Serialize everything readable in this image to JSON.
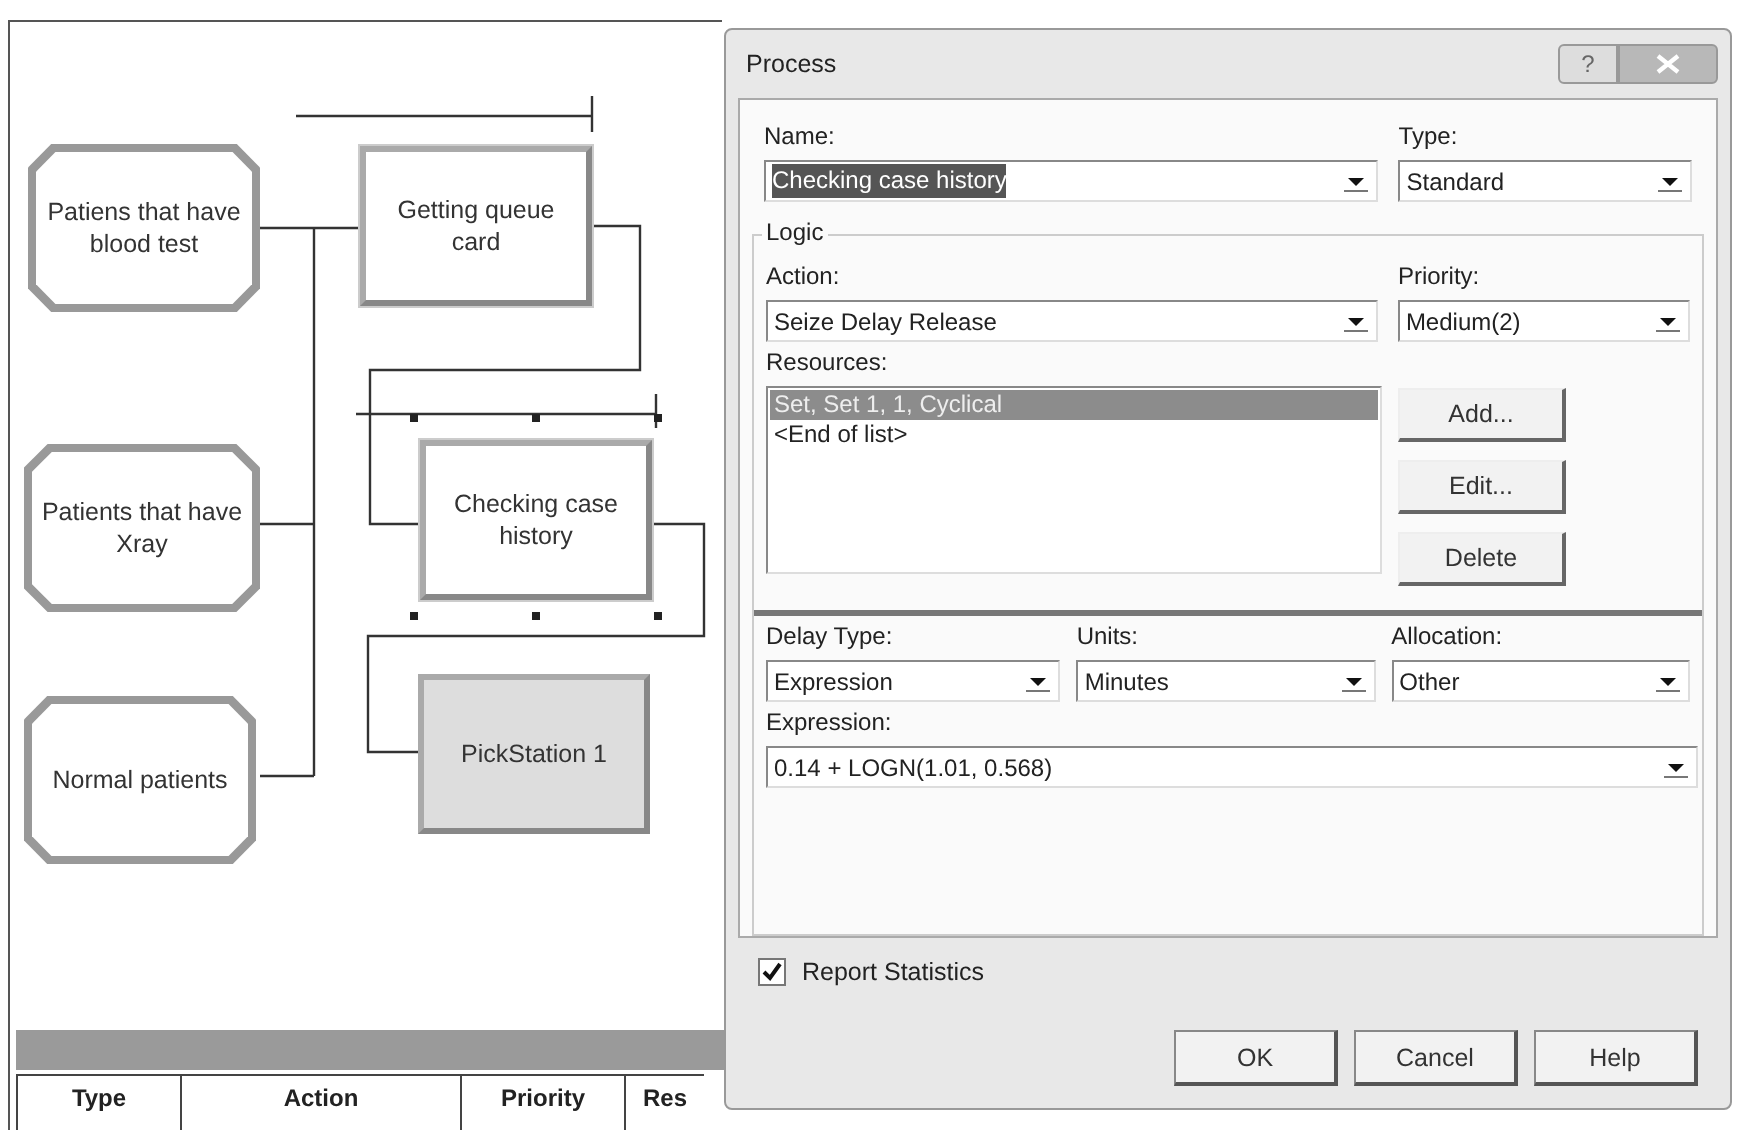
{
  "canvas": {
    "modules": [
      {
        "kind": "create",
        "label": "Patiens that have blood test",
        "selected": false
      },
      {
        "kind": "create",
        "label": "Patients that have Xray",
        "selected": false
      },
      {
        "kind": "create",
        "label": "Normal patients",
        "selected": false
      },
      {
        "kind": "process",
        "label": "Getting queue card",
        "selected": false
      },
      {
        "kind": "process",
        "label": "Checking case history",
        "selected": true
      },
      {
        "kind": "pickstation",
        "label": "PickStation 1",
        "selected": false
      }
    ]
  },
  "table": {
    "columns": [
      "Type",
      "Action",
      "Priority",
      "Res"
    ]
  },
  "dialog": {
    "title": "Process",
    "help_button": "?",
    "name": {
      "label": "Name:",
      "value": "Checking case history",
      "highlighted": true
    },
    "type": {
      "label": "Type:",
      "value": "Standard"
    },
    "logic": {
      "legend": "Logic",
      "action": {
        "label": "Action:",
        "value": "Seize Delay Release"
      },
      "priority": {
        "label": "Priority:",
        "value": "Medium(2)"
      },
      "resources": {
        "label": "Resources:",
        "items": [
          {
            "text": "Set, Set 1, 1, Cyclical",
            "selected": true
          },
          {
            "text": "<End of list>",
            "selected": false
          }
        ],
        "buttons": [
          "Add...",
          "Edit...",
          "Delete"
        ]
      },
      "delay_type": {
        "label": "Delay Type:",
        "value": "Expression"
      },
      "units": {
        "label": "Units:",
        "value": "Minutes"
      },
      "allocation": {
        "label": "Allocation:",
        "value": "Other"
      },
      "expression": {
        "label": "Expression:",
        "value": "0.14 + LOGN(1.01, 0.568)"
      }
    },
    "report_statistics": {
      "label": "Report Statistics",
      "checked": true
    },
    "buttons": [
      "OK",
      "Cancel",
      "Help"
    ]
  }
}
